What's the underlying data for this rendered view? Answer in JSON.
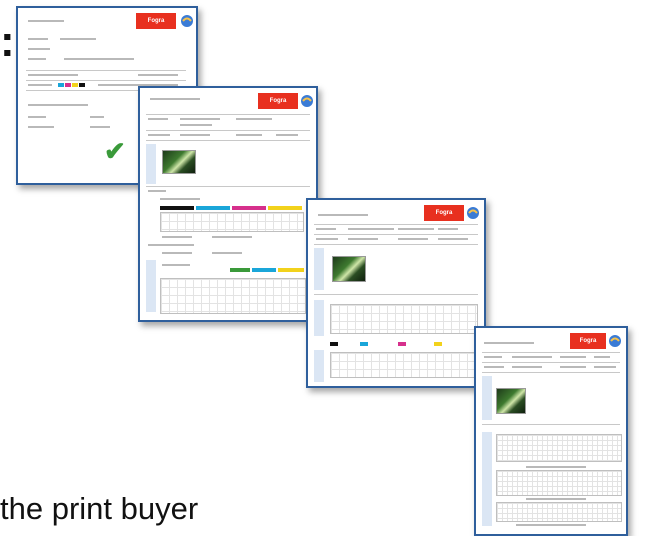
{
  "colon": ":",
  "caption": "the print buyer",
  "reports": [
    {
      "logo_text": "Fogra"
    },
    {
      "logo_text": "Fogra"
    },
    {
      "logo_text": "Fogra"
    },
    {
      "logo_text": "Fogra"
    }
  ],
  "colors": {
    "frame": "#2f5f9c",
    "logo": "#e8301f",
    "check": "#3a9a3a",
    "cyan": "#1aa6d9",
    "magenta": "#d6308c",
    "yellow": "#f2d21c",
    "black": "#111111"
  },
  "icons": [
    "checkmark-icon",
    "globe-icon"
  ]
}
